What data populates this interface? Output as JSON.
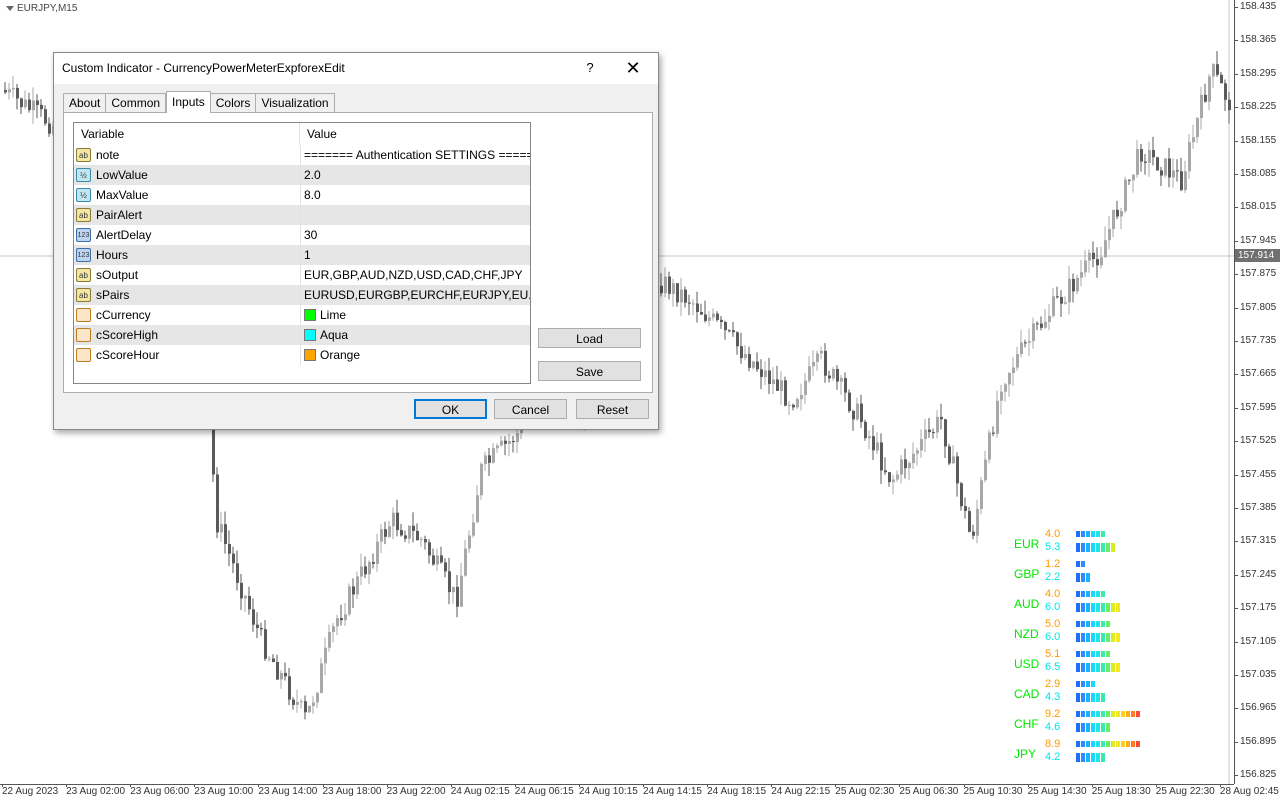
{
  "chart": {
    "symbol": "EURJPY,M15",
    "current_price": "157.914",
    "price_ticks": [
      "158.435",
      "158.365",
      "158.295",
      "158.225",
      "158.155",
      "158.085",
      "158.015",
      "157.945",
      "157.875",
      "157.805",
      "157.735",
      "157.665",
      "157.595",
      "157.525",
      "157.455",
      "157.385",
      "157.315",
      "157.245",
      "157.175",
      "157.105",
      "157.035",
      "156.965",
      "156.895",
      "156.825"
    ],
    "time_ticks": [
      "22 Aug 2023",
      "23 Aug 02:00",
      "23 Aug 06:00",
      "23 Aug 10:00",
      "23 Aug 14:00",
      "23 Aug 18:00",
      "23 Aug 22:00",
      "24 Aug 02:15",
      "24 Aug 06:15",
      "24 Aug 10:15",
      "24 Aug 14:15",
      "24 Aug 18:15",
      "24 Aug 22:15",
      "25 Aug 02:30",
      "25 Aug 06:30",
      "25 Aug 10:30",
      "25 Aug 14:30",
      "25 Aug 18:30",
      "25 Aug 22:30",
      "28 Aug 02:45"
    ]
  },
  "dialog": {
    "title": "Custom Indicator - CurrencyPowerMeterExpforexEdit",
    "help": "?",
    "close": "✕",
    "tabs": [
      "About",
      "Common",
      "Inputs",
      "Colors",
      "Visualization"
    ],
    "active_tab": "Inputs",
    "columns": {
      "variable": "Variable",
      "value": "Value"
    },
    "rows": [
      {
        "icon": "ab",
        "icon_label": "ab",
        "name": "note",
        "value": "======= Authentication SETTINGS ======"
      },
      {
        "icon": "dbl",
        "icon_label": "½",
        "name": "LowValue",
        "value": "2.0"
      },
      {
        "icon": "dbl",
        "icon_label": "½",
        "name": "MaxValue",
        "value": "8.0"
      },
      {
        "icon": "ab",
        "icon_label": "ab",
        "name": "PairAlert",
        "value": ""
      },
      {
        "icon": "int",
        "icon_label": "123",
        "name": "AlertDelay",
        "value": "30"
      },
      {
        "icon": "int",
        "icon_label": "123",
        "name": "Hours",
        "value": "1"
      },
      {
        "icon": "ab",
        "icon_label": "ab",
        "name": "sOutput",
        "value": "EUR,GBP,AUD,NZD,USD,CAD,CHF,JPY"
      },
      {
        "icon": "ab",
        "icon_label": "ab",
        "name": "sPairs",
        "value": "EURUSD,EURGBP,EURCHF,EURJPY,EU..."
      },
      {
        "icon": "clr",
        "icon_label": "",
        "name": "cCurrency",
        "value": "Lime",
        "color": "#00ff00"
      },
      {
        "icon": "clr",
        "icon_label": "",
        "name": "cScoreHigh",
        "value": "Aqua",
        "color": "#00ffff"
      },
      {
        "icon": "clr",
        "icon_label": "",
        "name": "cScoreHour",
        "value": "Orange",
        "color": "#ffa500"
      }
    ],
    "buttons": {
      "load": "Load",
      "save": "Save",
      "ok": "OK",
      "cancel": "Cancel",
      "reset": "Reset"
    }
  },
  "meter": {
    "colors": {
      "currency": "#00e600",
      "score_hour": "#ff9900",
      "score_high": "#00e5e5"
    },
    "rows": [
      {
        "currency": "EUR",
        "hour": "4.0",
        "high": "5.3",
        "hour_value": 4.0,
        "high_value": 5.3
      },
      {
        "currency": "GBP",
        "hour": "1.2",
        "high": "2.2",
        "hour_value": 1.2,
        "high_value": 2.2
      },
      {
        "currency": "AUD",
        "hour": "4.0",
        "high": "6.0",
        "hour_value": 4.0,
        "high_value": 6.0
      },
      {
        "currency": "NZD",
        "hour": "5.0",
        "high": "6.0",
        "hour_value": 5.0,
        "high_value": 6.0
      },
      {
        "currency": "USD",
        "hour": "5.1",
        "high": "6.5",
        "hour_value": 5.1,
        "high_value": 6.5
      },
      {
        "currency": "CAD",
        "hour": "2.9",
        "high": "4.3",
        "hour_value": 2.9,
        "high_value": 4.3
      },
      {
        "currency": "CHF",
        "hour": "9.2",
        "high": "4.6",
        "hour_value": 9.2,
        "high_value": 4.6
      },
      {
        "currency": "JPY",
        "hour": "8.9",
        "high": "4.2",
        "hour_value": 8.9,
        "high_value": 4.2
      }
    ]
  }
}
